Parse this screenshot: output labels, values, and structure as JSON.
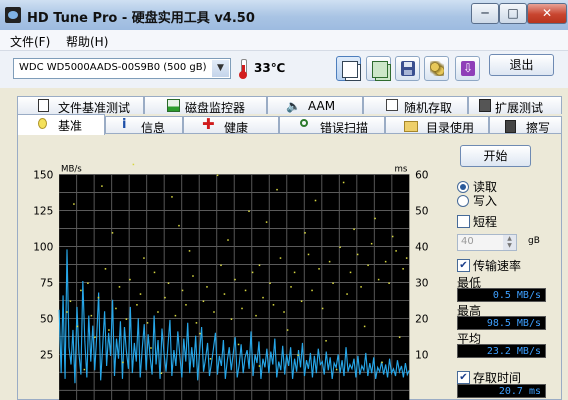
{
  "window": {
    "title": "HD Tune Pro - 硬盘实用工具 v4.50",
    "btn_min": "─",
    "btn_max": "□",
    "btn_close": "✕"
  },
  "menu": {
    "items": [
      {
        "label": "文件(F)"
      },
      {
        "label": "帮助(H)"
      }
    ]
  },
  "toolbar": {
    "drive": "WDC WD5000AADS-00S9B0 (500 gB)",
    "temperature": "33℃",
    "exit_label": "退出",
    "down_glyph": "⇩"
  },
  "tabs_top": [
    {
      "label": "文件基准测试",
      "icon": "document-icon"
    },
    {
      "label": "磁盘监控器",
      "icon": "monitor-chart-icon"
    },
    {
      "label": "AAM",
      "icon": "speaker-icon"
    },
    {
      "label": "随机存取",
      "icon": "dice-icon"
    },
    {
      "label": "扩展测试",
      "icon": "disk-test-icon"
    }
  ],
  "tabs_bottom": [
    {
      "label": "基准",
      "icon": "bulb-icon",
      "selected": true
    },
    {
      "label": "信息",
      "icon": "info-icon"
    },
    {
      "label": "健康",
      "icon": "health-cross-icon"
    },
    {
      "label": "错误扫描",
      "icon": "magnifier-icon"
    },
    {
      "label": "目录使用",
      "icon": "folder-icon"
    },
    {
      "label": "擦写",
      "icon": "trash-icon"
    }
  ],
  "side": {
    "start_label": "开始",
    "read_label": "读取",
    "write_label": "写入",
    "read_selected": true,
    "short_label": "短程",
    "short_checked": false,
    "spin_value": "40",
    "spin_unit": "gB",
    "transfer_label": "传输速率",
    "transfer_checked": true,
    "min_label": "最低",
    "min_value": "0.5 MB/s",
    "max_label": "最高",
    "max_value": "98.5 MB/s",
    "avg_label": "平均",
    "avg_value": "23.2 MB/s",
    "access_label": "存取时间",
    "access_checked": true,
    "access_value": "20.7 ms"
  },
  "chart_data": {
    "type": "line",
    "ylabel_left": "MB/s",
    "ylabel_right": "ms",
    "y_left_ticks": [
      150,
      125,
      100,
      75,
      50,
      25
    ],
    "y_right_ticks": [
      60,
      50,
      40,
      30,
      20,
      10
    ],
    "ylim_left": [
      0,
      150
    ],
    "ylim_right": [
      0,
      60
    ],
    "grid": true,
    "colors": {
      "background": "#000000",
      "grid": "#5a5a5a",
      "transfer": "#26a6e8",
      "access": "#d6d640"
    },
    "series": [
      {
        "name": "传输速率",
        "y_axis": "left",
        "style": "line",
        "values": [
          56,
          12,
          66,
          8,
          98,
          30,
          18,
          42,
          5,
          58,
          26,
          11,
          76,
          34,
          9,
          52,
          20,
          45,
          14,
          38,
          68,
          7,
          31,
          55,
          17,
          40,
          24,
          63,
          10,
          36,
          22,
          48,
          8,
          44,
          27,
          15,
          58,
          12,
          33,
          20,
          50,
          9,
          29,
          46,
          14,
          39,
          23,
          11,
          52,
          18,
          35,
          8,
          43,
          26,
          13,
          31,
          49,
          10,
          28,
          17,
          41,
          24,
          9,
          36,
          20,
          47,
          12,
          30,
          16,
          38,
          7,
          27,
          44,
          13,
          22,
          33,
          10,
          19,
          29,
          40,
          11,
          24,
          17,
          35,
          8,
          21,
          30,
          14,
          26,
          37,
          9,
          18,
          32,
          12,
          23,
          28,
          15,
          41,
          10,
          25,
          19,
          34,
          8,
          22,
          16,
          29,
          12,
          27,
          18,
          36,
          9,
          20,
          14,
          31,
          11,
          25,
          17,
          30,
          8,
          22,
          13,
          28,
          16,
          33,
          10,
          21,
          15,
          26,
          9,
          24,
          12,
          29,
          18,
          20,
          11,
          27,
          14,
          23,
          8,
          19,
          16,
          25,
          12,
          21,
          10,
          30,
          13,
          18,
          15,
          22,
          9,
          24,
          11,
          17,
          14,
          26,
          10,
          19,
          12,
          23,
          8,
          16,
          13,
          20,
          11,
          18,
          9,
          22,
          12,
          15,
          10,
          21,
          13,
          17,
          9,
          19,
          11,
          14
        ]
      },
      {
        "name": "存取时间",
        "y_axis": "right",
        "style": "scatter",
        "points": [
          [
            0.02,
            22
          ],
          [
            0.03,
            25
          ],
          [
            0.05,
            18
          ],
          [
            0.06,
            28
          ],
          [
            0.08,
            30
          ],
          [
            0.09,
            21
          ],
          [
            0.11,
            26
          ],
          [
            0.13,
            34
          ],
          [
            0.14,
            17
          ],
          [
            0.16,
            23
          ],
          [
            0.17,
            29
          ],
          [
            0.19,
            20
          ],
          [
            0.2,
            31
          ],
          [
            0.22,
            24
          ],
          [
            0.23,
            27
          ],
          [
            0.25,
            19
          ],
          [
            0.27,
            33
          ],
          [
            0.28,
            22
          ],
          [
            0.3,
            26
          ],
          [
            0.31,
            30
          ],
          [
            0.33,
            21
          ],
          [
            0.35,
            28
          ],
          [
            0.36,
            24
          ],
          [
            0.38,
            32
          ],
          [
            0.39,
            19
          ],
          [
            0.41,
            25
          ],
          [
            0.42,
            29
          ],
          [
            0.44,
            22
          ],
          [
            0.46,
            35
          ],
          [
            0.47,
            27
          ],
          [
            0.49,
            20
          ],
          [
            0.5,
            31
          ],
          [
            0.52,
            23
          ],
          [
            0.53,
            28
          ],
          [
            0.55,
            33
          ],
          [
            0.56,
            21
          ],
          [
            0.58,
            26
          ],
          [
            0.6,
            30
          ],
          [
            0.61,
            24
          ],
          [
            0.63,
            37
          ],
          [
            0.64,
            22
          ],
          [
            0.66,
            29
          ],
          [
            0.67,
            33
          ],
          [
            0.69,
            25
          ],
          [
            0.71,
            38
          ],
          [
            0.72,
            28
          ],
          [
            0.74,
            34
          ],
          [
            0.75,
            23
          ],
          [
            0.77,
            36
          ],
          [
            0.78,
            30
          ],
          [
            0.8,
            40
          ],
          [
            0.82,
            27
          ],
          [
            0.83,
            33
          ],
          [
            0.85,
            38
          ],
          [
            0.86,
            29
          ],
          [
            0.88,
            35
          ],
          [
            0.89,
            41
          ],
          [
            0.91,
            31
          ],
          [
            0.93,
            36
          ],
          [
            0.94,
            30
          ],
          [
            0.96,
            39
          ],
          [
            0.98,
            34
          ],
          [
            0.99,
            37
          ],
          [
            0.04,
            52
          ],
          [
            0.12,
            57
          ],
          [
            0.21,
            63
          ],
          [
            0.32,
            54
          ],
          [
            0.45,
            60
          ],
          [
            0.54,
            50
          ],
          [
            0.62,
            56
          ],
          [
            0.73,
            53
          ],
          [
            0.81,
            58
          ],
          [
            0.9,
            48
          ],
          [
            0.07,
            6
          ],
          [
            0.18,
            8
          ],
          [
            0.29,
            5
          ],
          [
            0.43,
            9
          ],
          [
            0.57,
            7
          ],
          [
            0.68,
            10
          ],
          [
            0.79,
            6
          ],
          [
            0.92,
            8
          ],
          [
            0.1,
            15
          ],
          [
            0.26,
            12
          ],
          [
            0.4,
            16
          ],
          [
            0.51,
            13
          ],
          [
            0.65,
            17
          ],
          [
            0.76,
            14
          ],
          [
            0.87,
            18
          ],
          [
            0.97,
            15
          ],
          [
            0.15,
            44
          ],
          [
            0.34,
            46
          ],
          [
            0.48,
            42
          ],
          [
            0.59,
            47
          ],
          [
            0.7,
            44
          ],
          [
            0.84,
            45
          ],
          [
            0.95,
            43
          ],
          [
            0.24,
            37
          ],
          [
            0.37,
            39
          ],
          [
            0.57,
            35
          ]
        ]
      }
    ]
  }
}
